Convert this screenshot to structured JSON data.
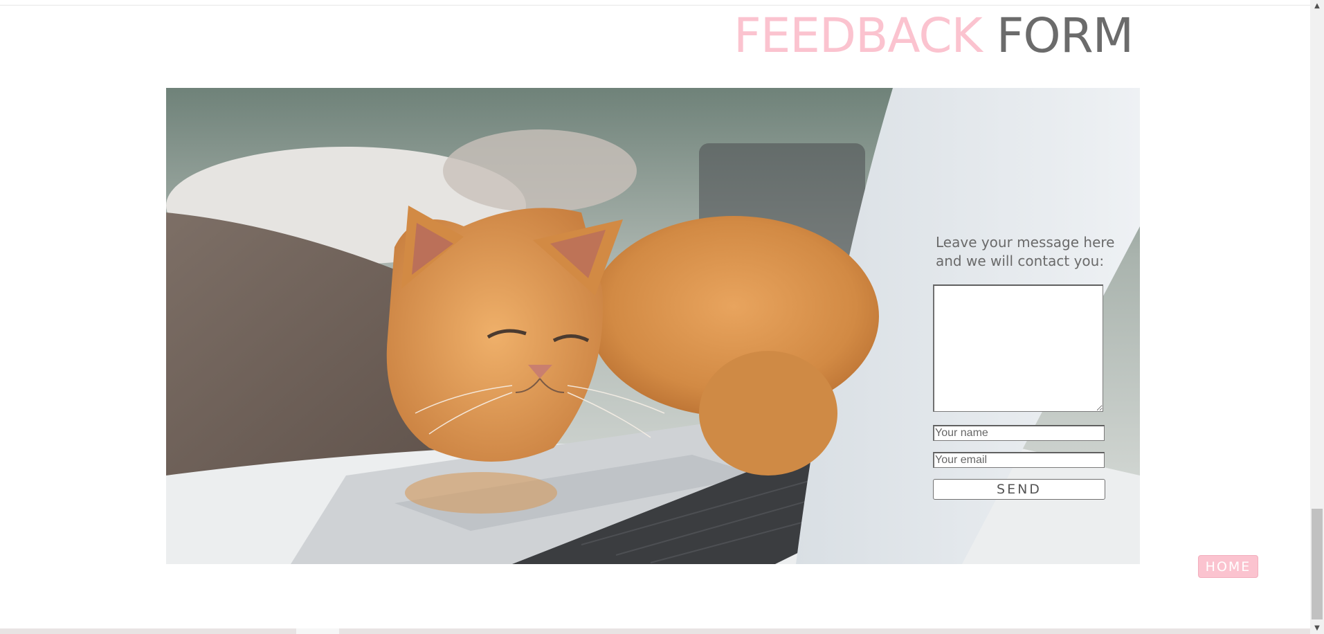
{
  "title": {
    "part1": "FEEDBACK",
    "part2": "FORM"
  },
  "colors": {
    "accent_pink": "#fbc3cf",
    "title_gray": "#6b6b6b"
  },
  "hero": {
    "description_icon": "cat-with-laptop-photo"
  },
  "form": {
    "intro": "Leave your message here and we will contact you:",
    "message_value": "",
    "name_placeholder": "Your name",
    "email_placeholder": "Your email",
    "send_label": "SEND"
  },
  "nav": {
    "home_label": "HOME"
  },
  "scrollbar": {
    "up_icon": "chevron-up-icon",
    "down_icon": "chevron-down-icon"
  }
}
